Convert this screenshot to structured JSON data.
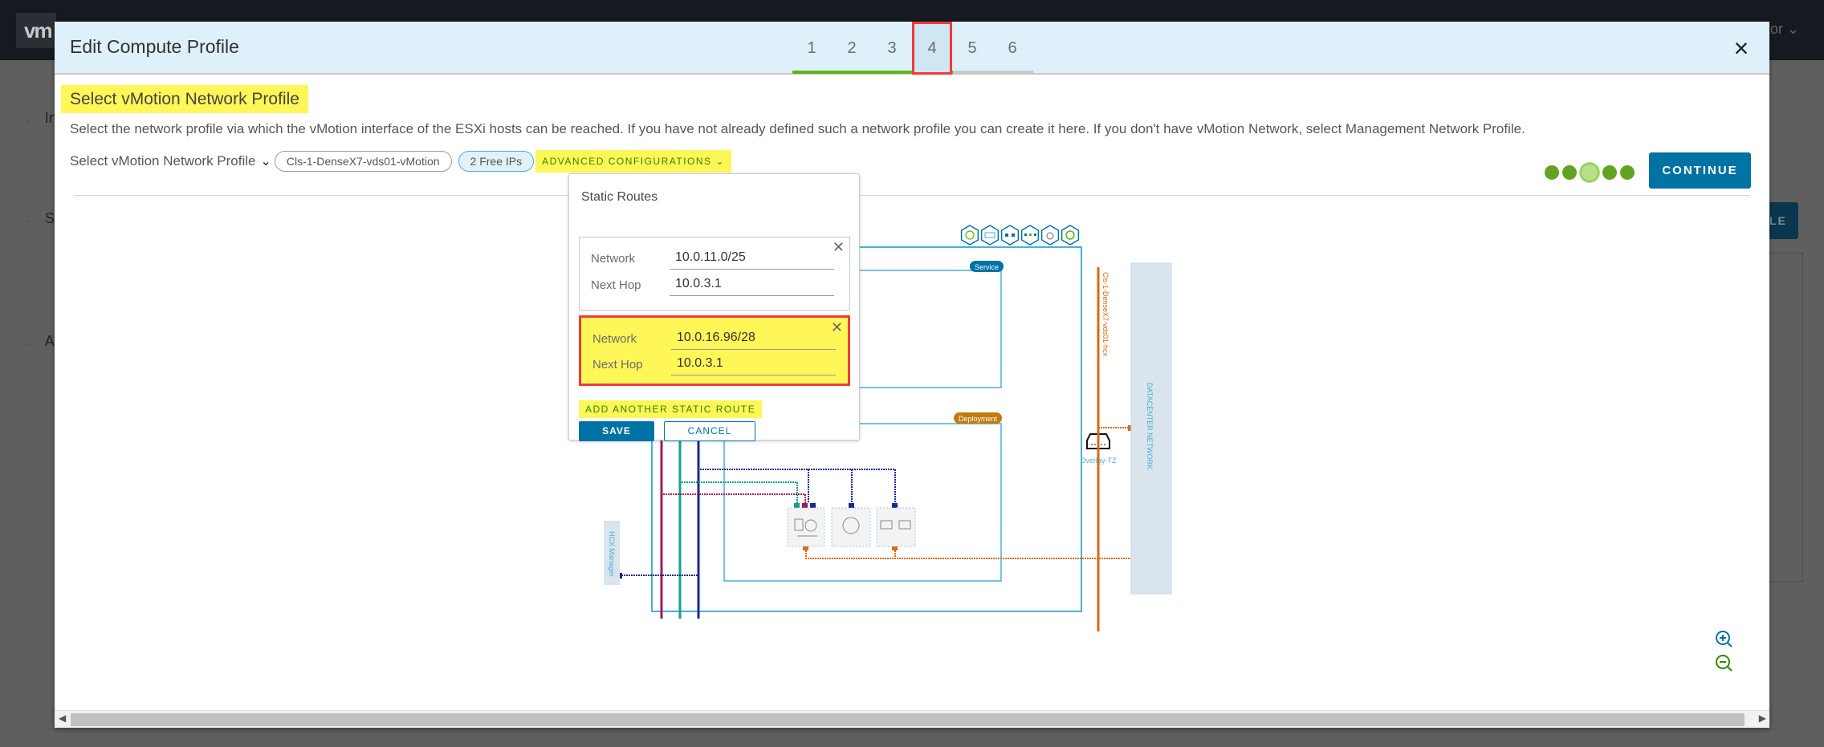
{
  "background": {
    "logo": "vm",
    "user_menu": "tor",
    "nav_items": [
      "In",
      "Se",
      "A"
    ],
    "bg_button": "LE"
  },
  "modal": {
    "title": "Edit Compute Profile",
    "steps": [
      "1",
      "2",
      "3",
      "4",
      "5",
      "6"
    ],
    "active_step": 4,
    "close_label": "×",
    "section_title": "Select vMotion Network Profile",
    "description": "Select the network profile via which the vMotion interface of the ESXi hosts can be reached. If you have not already defined such a network profile you can create it here. If you don't have vMotion Network, select Management Network Profile.",
    "profile_label": "Select vMotion Network Profile",
    "selected_profile": "Cls-1-DenseX7-vds01-vMotion",
    "free_ips": "2 Free IPs",
    "advanced_label": "ADVANCED CONFIGURATIONS",
    "continue_label": "CONTINUE",
    "progress": {
      "total": 5,
      "current": 3
    }
  },
  "static_routes": {
    "title": "Static Routes",
    "routes": [
      {
        "network_label": "Network",
        "network": "10.0.11.0/25",
        "next_hop_label": "Next Hop",
        "next_hop": "10.0.3.1"
      },
      {
        "network_label": "Network",
        "network": "10.0.16.96/28",
        "next_hop_label": "Next Hop",
        "next_hop": "10.0.3.1"
      }
    ],
    "add_label": "ADD ANOTHER STATIC ROUTE",
    "save_label": "SAVE",
    "cancel_label": "CANCEL"
  },
  "diagram": {
    "service_badge": "Service",
    "deployment_badge": "Deployment",
    "overlay_label": "Overlay-TZ",
    "hcx_network_label": "Cls-1-DenseX7-vds01-hcx",
    "datacenter_label": "DATACENTER NETWORK",
    "hcx_manager_label": "HCX Manager",
    "service_icons": [
      "vmotion-icon",
      "bulk-migration-icon",
      "network-extension-icon",
      "wan-optimization-icon",
      "cloud-migration-icon",
      "disaster-recovery-icon"
    ],
    "colors": {
      "frame": "#49afd9",
      "magenta": "#a3195b",
      "teal": "#14a088",
      "navy": "#1a2a8a",
      "orange": "#d86a10",
      "service_badge": "#0072a3",
      "deployment_badge": "#c27a0e"
    }
  },
  "zoom": {
    "in": "zoom-in",
    "out": "zoom-out"
  }
}
